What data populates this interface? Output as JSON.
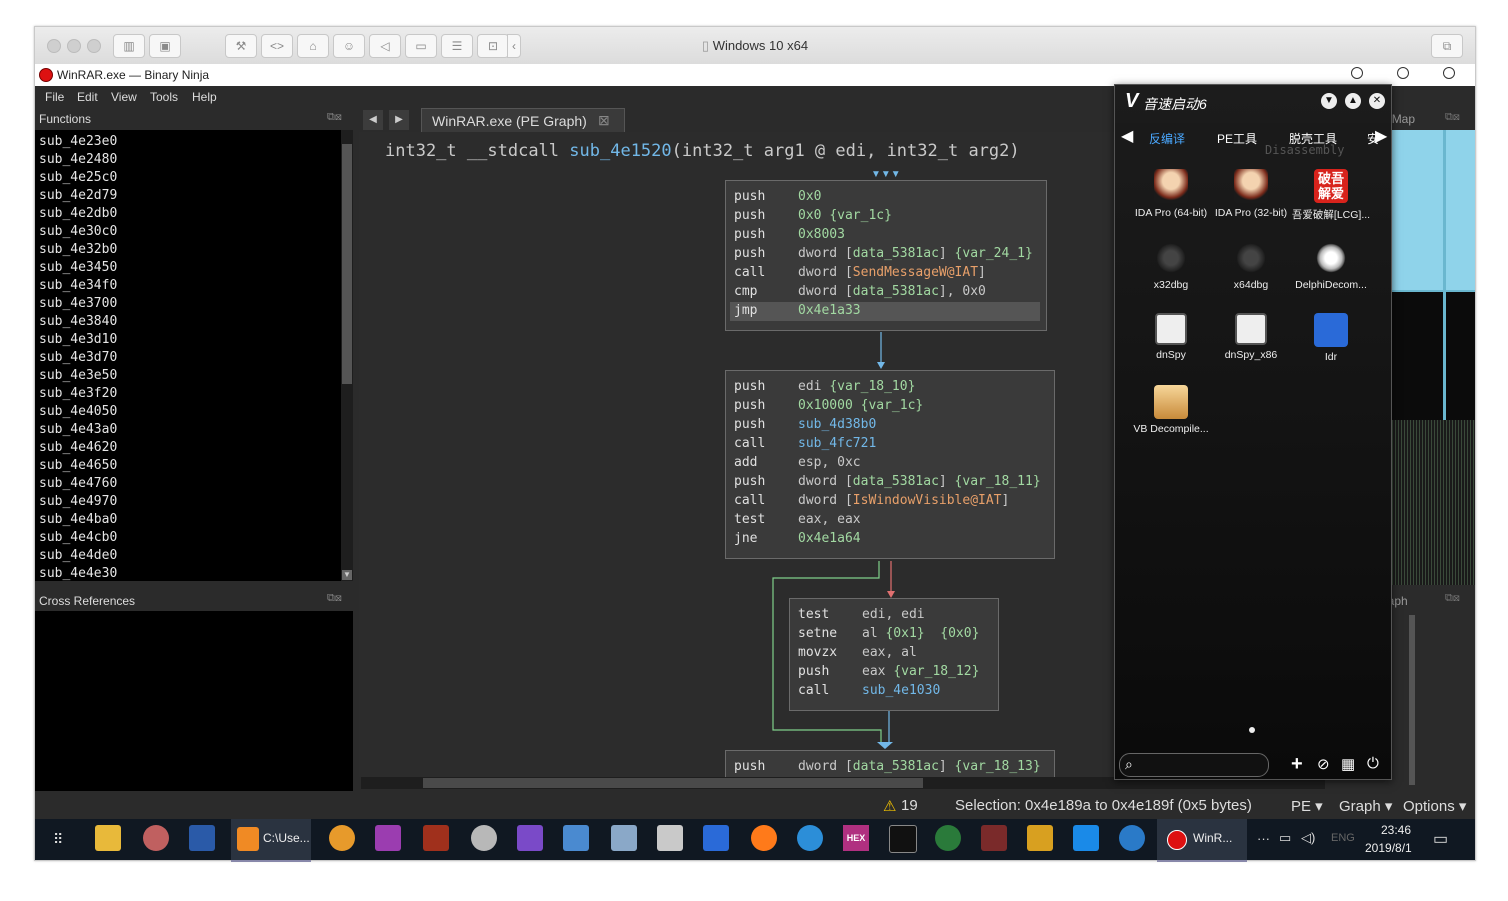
{
  "vm": {
    "title": "Windows 10 x64"
  },
  "app": {
    "title": "WinRAR.exe — Binary Ninja",
    "menu": [
      "File",
      "Edit",
      "View",
      "Tools",
      "Help"
    ]
  },
  "functions_panel": {
    "title": "Functions",
    "items": [
      "sub_4e23e0",
      "sub_4e2480",
      "sub_4e25c0",
      "sub_4e2d79",
      "sub_4e2db0",
      "sub_4e30c0",
      "sub_4e32b0",
      "sub_4e3450",
      "sub_4e34f0",
      "sub_4e3700",
      "sub_4e3840",
      "sub_4e3d10",
      "sub_4e3d70",
      "sub_4e3e50",
      "sub_4e3f20",
      "sub_4e4050",
      "sub_4e43a0",
      "sub_4e4620",
      "sub_4e4650",
      "sub_4e4760",
      "sub_4e4970",
      "sub_4e4ba0",
      "sub_4e4cb0",
      "sub_4e4de0",
      "sub_4e4e30"
    ]
  },
  "xrefs_panel": {
    "title": "Cross References"
  },
  "editor": {
    "tab_label": "WinRAR.exe (PE Graph)",
    "signature": {
      "ret": "int32_t",
      "conv": "__stdcall",
      "name": "sub_4e1520",
      "params": "(int32_t arg1 @ edi, int32_t arg2)"
    },
    "blocks": [
      [
        [
          "push",
          "0x0",
          ""
        ],
        [
          "push",
          "0x0",
          "{var_1c}"
        ],
        [
          "push",
          "0x8003",
          ""
        ],
        [
          "push",
          "dword [data_5381ac]",
          "{var_24_1}"
        ],
        [
          "call",
          "dword [SendMessageW@IAT]",
          ""
        ],
        [
          "cmp",
          "dword [data_5381ac], 0x0",
          ""
        ],
        [
          "jmp",
          "0x4e1a33",
          ""
        ]
      ],
      [
        [
          "push",
          "edi",
          "{var_18_10}"
        ],
        [
          "push",
          "0x10000",
          "{var_1c}"
        ],
        [
          "push",
          "sub_4d38b0",
          ""
        ],
        [
          "call",
          "sub_4fc721",
          ""
        ],
        [
          "add",
          "esp, 0xc",
          ""
        ],
        [
          "push",
          "dword [data_5381ac]",
          "{var_18_11}"
        ],
        [
          "call",
          "dword [IsWindowVisible@IAT]",
          ""
        ],
        [
          "test",
          "eax, eax",
          ""
        ],
        [
          "jne",
          "0x4e1a64",
          ""
        ]
      ],
      [
        [
          "test",
          "edi, edi",
          ""
        ],
        [
          "setne",
          "al",
          "{0x1}  {0x0}"
        ],
        [
          "movzx",
          "eax, al",
          ""
        ],
        [
          "push",
          "eax",
          "{var_18_12}"
        ],
        [
          "call",
          "sub_4e1030",
          ""
        ]
      ],
      [
        [
          "push",
          "dword [data_5381ac]",
          "{var_18_13}"
        ]
      ]
    ]
  },
  "right_panels": {
    "feature_map": "Feature Map",
    "mini_graph": "Mini Graph",
    "disassembly": "Disassembly"
  },
  "status": {
    "warnings": "19",
    "selection": "Selection: 0x4e189a to 0x4e189f (0x5 bytes)",
    "arch": "PE",
    "view": "Graph",
    "options": "Options"
  },
  "launcher": {
    "title": "音速启动6",
    "tabs": [
      "反编译",
      "PE工具",
      "脱壳工具",
      "安"
    ],
    "apps": [
      "IDA Pro (64-bit)",
      "IDA Pro (32-bit)",
      "吾爱破解[LCG]...",
      "x32dbg",
      "x64dbg",
      "DelphiDecom...",
      "dnSpy",
      "dnSpy_x86",
      "Idr",
      "VB Decompile..."
    ],
    "icons": {
      "ida64": "ida-icon",
      "lcg": "52pojie-icon",
      "dbg": "bug-icon",
      "delphi": "compass-icon",
      "dnspy": "dnspy-icon",
      "idr": "idr-icon",
      "vb": "vb-icon"
    },
    "red_icon_text": "破吾\n解爱"
  },
  "taskbar": {
    "sublime_label": "C:\\Use...",
    "winrar_label": "WinR...",
    "time": "23:46",
    "date": "2019/8/1",
    "lang": "ENG",
    "hex_label": "HEX"
  }
}
